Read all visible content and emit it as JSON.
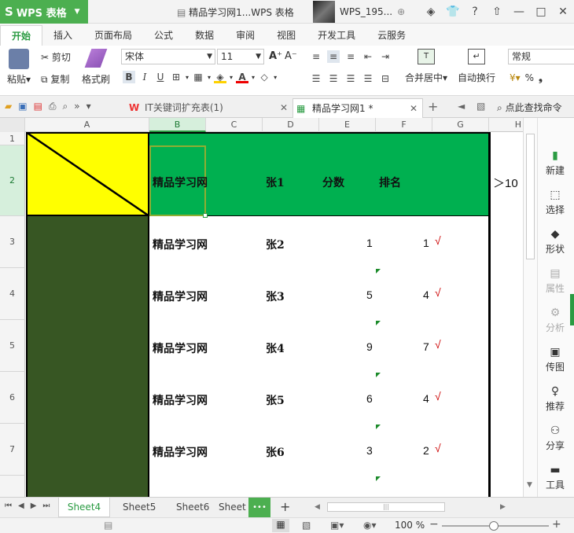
{
  "app": {
    "name": "WPS 表格",
    "window_title": "精品学习网1...WPS 表格",
    "user": "WPS_195..."
  },
  "menu": {
    "tabs": [
      "开始",
      "插入",
      "页面布局",
      "公式",
      "数据",
      "审阅",
      "视图",
      "开发工具",
      "云服务"
    ]
  },
  "toolbar": {
    "paste": "粘贴",
    "cut": "剪切",
    "copy": "复制",
    "format_painter": "格式刷",
    "font_name": "宋体",
    "font_size": "11",
    "bold": "B",
    "italic": "I",
    "underline": "U",
    "merge_center": "合并居中",
    "wrap_text": "自动换行",
    "number_format": "常规",
    "percent": "%",
    "comma": "❟"
  },
  "doc_tabs": {
    "tab1": "IT关键词扩充表(1)",
    "tab2": "精品学习网1 *",
    "find_cmd": "点此查找命令"
  },
  "sheet": {
    "columns": [
      "A",
      "B",
      "C",
      "D",
      "E",
      "F",
      "G",
      "H"
    ],
    "rows": [
      "1",
      "2",
      "3",
      "4",
      "5",
      "6",
      "7"
    ],
    "header_row": {
      "b": "精品学习网",
      "d": "张1",
      "e": "分数",
      "f": "排名",
      "h": "＞10"
    },
    "data_rows": [
      {
        "b": "精品学习网",
        "d": "张2",
        "e": "1",
        "f": "1",
        "check": "√"
      },
      {
        "b": "精品学习网",
        "d": "张3",
        "e": "5",
        "f": "4",
        "check": "√"
      },
      {
        "b": "精品学习网",
        "d": "张4",
        "e": "9",
        "f": "7",
        "check": "√"
      },
      {
        "b": "精品学习网",
        "d": "张5",
        "e": "6",
        "f": "4",
        "check": "√"
      },
      {
        "b": "精品学习网",
        "d": "张6",
        "e": "3",
        "f": "2",
        "check": "√"
      }
    ],
    "colors": {
      "yellow": "#ffff00",
      "green": "#00b050",
      "dark_green": "#375623"
    }
  },
  "sidebar": {
    "items": [
      "新建",
      "选择",
      "形状",
      "属性",
      "分析",
      "传图",
      "推荐",
      "分享",
      "工具"
    ]
  },
  "sheet_tabs": {
    "tabs": [
      "Sheet4",
      "Sheet5",
      "Sheet6",
      "Sheet"
    ],
    "more": "•••",
    "add": "+"
  },
  "status": {
    "zoom": "100 %"
  }
}
